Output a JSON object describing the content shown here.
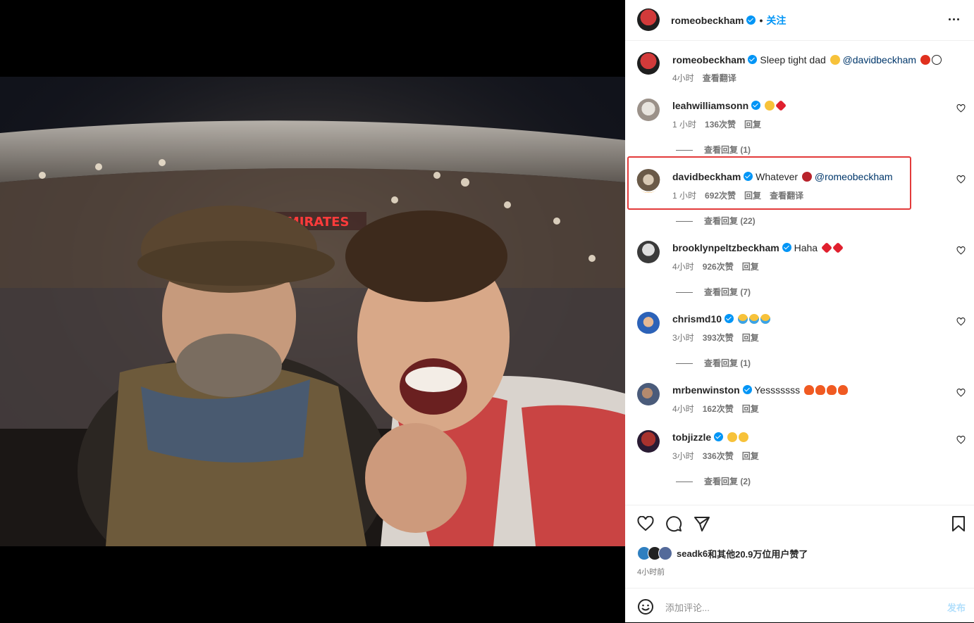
{
  "header": {
    "username": "romeobeckham",
    "separator": "•",
    "follow_label": "关注"
  },
  "caption": {
    "username": "romeobeckham",
    "text": "Sleep tight dad",
    "mention": "@davidbeckham",
    "time": "4小时",
    "translate": "查看翻译"
  },
  "comments": [
    {
      "username": "leahwilliamsonn",
      "text": "",
      "time": "1 小时",
      "likes": "136次赞",
      "reply": "回复",
      "view_replies": "查看回复 (1)"
    },
    {
      "username": "davidbeckham",
      "text": "Whatever",
      "mention": "@romeobeckham",
      "time": "1 小时",
      "likes": "692次赞",
      "reply": "回复",
      "translate": "查看翻译",
      "view_replies": "查看回复 (22)"
    },
    {
      "username": "brooklynpeltzbeckham",
      "text": "Haha",
      "time": "4小时",
      "likes": "926次赞",
      "reply": "回复",
      "view_replies": "查看回复 (7)"
    },
    {
      "username": "chrismd10",
      "text": "",
      "time": "3小时",
      "likes": "393次赞",
      "reply": "回复",
      "view_replies": "查看回复 (1)"
    },
    {
      "username": "mrbenwinston",
      "text": "Yesssssss",
      "time": "4小时",
      "likes": "162次赞",
      "reply": "回复"
    },
    {
      "username": "tobjizzle",
      "text": "",
      "time": "3小时",
      "likes": "336次赞",
      "reply": "回复",
      "view_replies": "查看回复 (2)"
    }
  ],
  "likes": {
    "first_user": "seadk6",
    "rest": "和其他20.9万位用户赞了"
  },
  "post_time": "4小时前",
  "comment_box": {
    "placeholder": "添加评论...",
    "post_label": "发布"
  },
  "icons": [
    "heart-icon",
    "comment-icon",
    "share-icon",
    "bookmark-icon",
    "emoji-icon",
    "more-icon",
    "verified-icon"
  ],
  "colors": {
    "accent": "#0095f6",
    "highlight_box": "#e33b3b",
    "mention": "#00376b"
  }
}
